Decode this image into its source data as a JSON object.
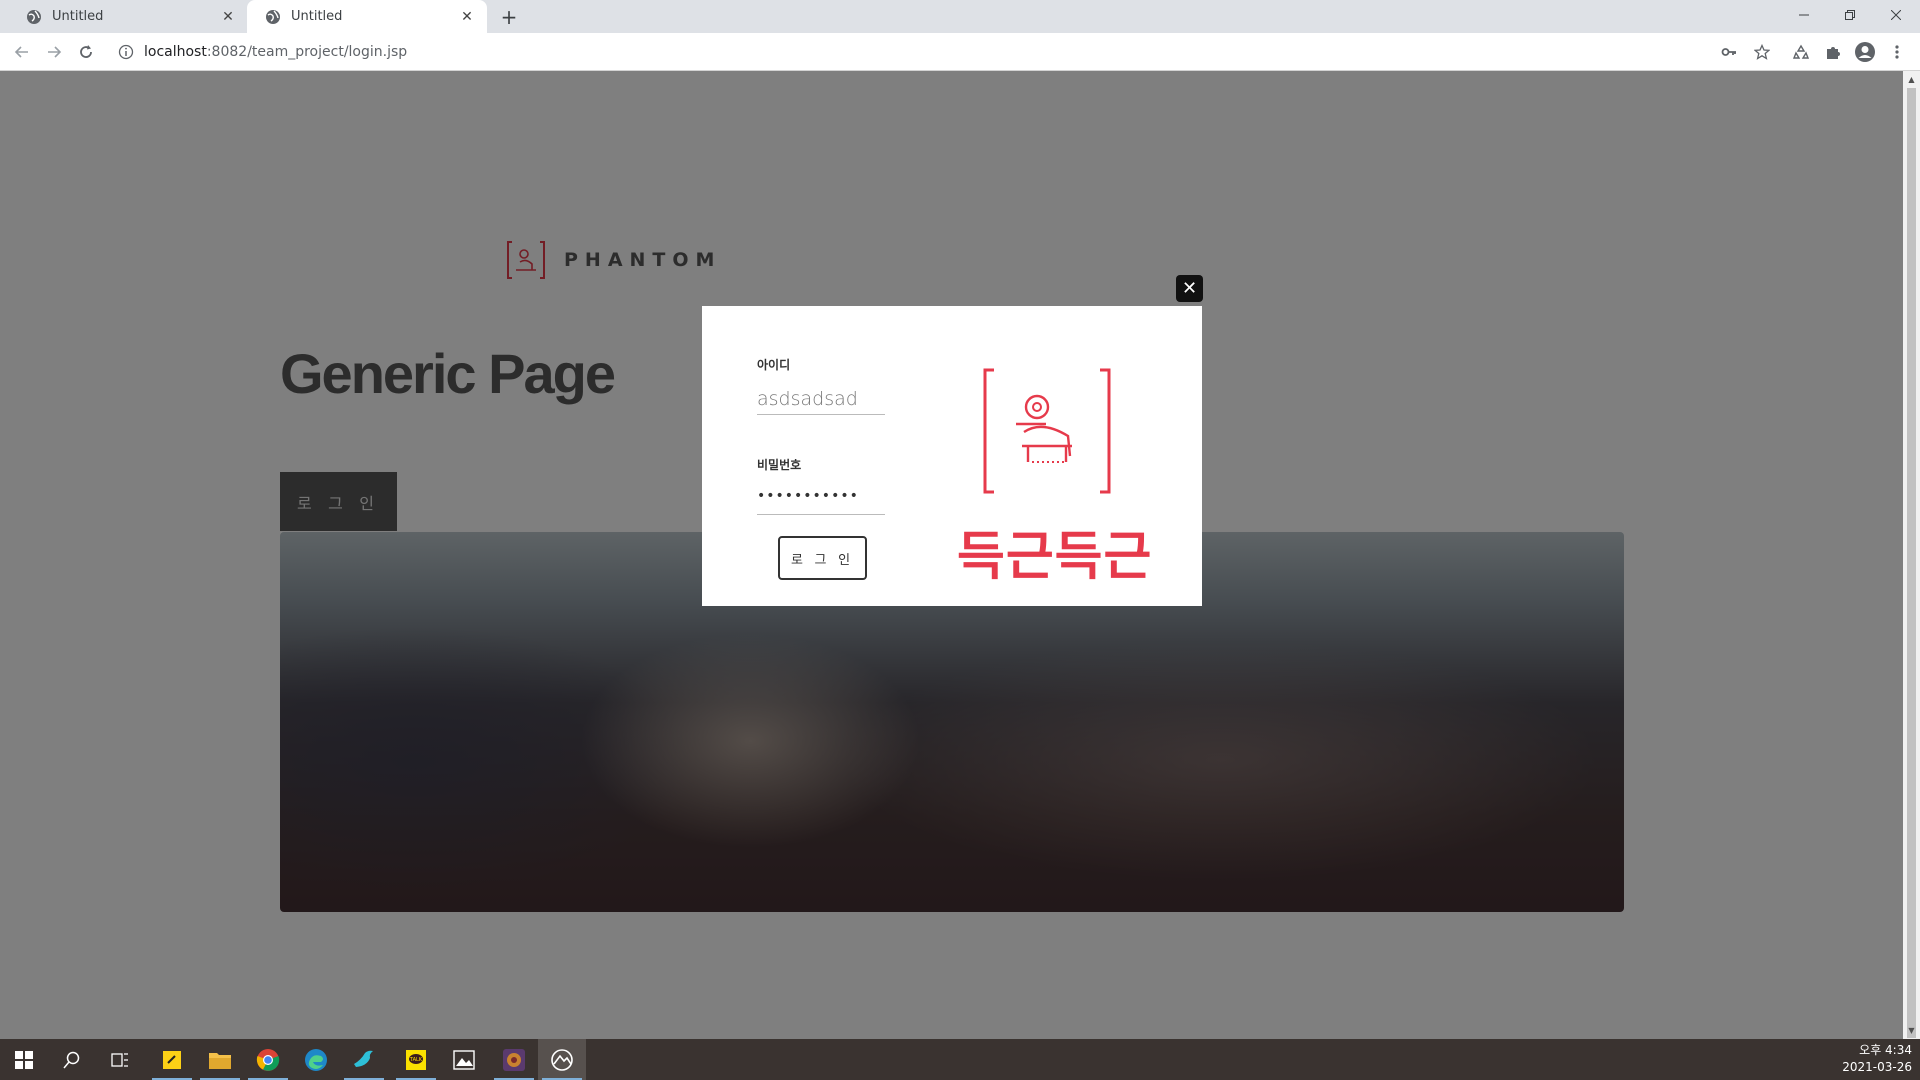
{
  "browser": {
    "tabs": [
      {
        "title": "Untitled",
        "active": false
      },
      {
        "title": "Untitled",
        "active": true
      }
    ],
    "url_host": "localhost",
    "url_path": ":8082/team_project/login.jsp"
  },
  "page": {
    "logo_text": "PHANTOM",
    "title": "Generic Page",
    "login_button": "로 그 인"
  },
  "modal": {
    "id_label": "아이디",
    "id_value": "asdsadsad",
    "password_label": "비밀번호",
    "password_value": "•••••••••••",
    "login_button": "로 그 인",
    "brand_name": "득근득근",
    "close_symbol": "✕"
  },
  "taskbar": {
    "time": "오후 4:34",
    "date": "2021-03-26"
  },
  "colors": {
    "brand_red": "#e63a4b",
    "page_dark": "#585858",
    "overlay": "rgba(0,0,0,0.5)"
  }
}
